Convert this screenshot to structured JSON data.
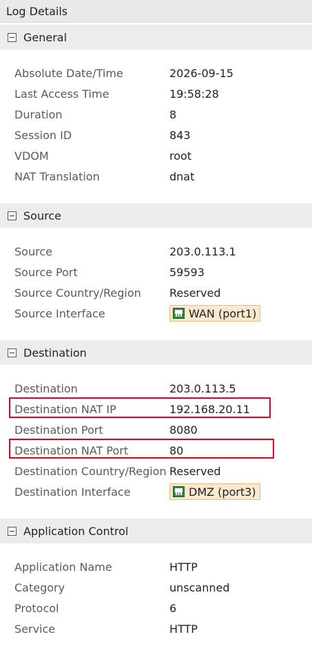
{
  "panel": {
    "title": "Log Details"
  },
  "sections": {
    "general": {
      "title": "General",
      "rows": [
        {
          "label": "Absolute Date/Time",
          "value": "2026-09-15"
        },
        {
          "label": "Last Access Time",
          "value": "19:58:28"
        },
        {
          "label": "Duration",
          "value": "8"
        },
        {
          "label": "Session ID",
          "value": "843"
        },
        {
          "label": "VDOM",
          "value": "root"
        },
        {
          "label": "NAT Translation",
          "value": "dnat"
        }
      ]
    },
    "source": {
      "title": "Source",
      "rows": [
        {
          "label": "Source",
          "value": "203.0.113.1"
        },
        {
          "label": "Source Port",
          "value": "59593"
        },
        {
          "label": "Source Country/Region",
          "value": "Reserved"
        },
        {
          "label": "Source Interface",
          "value": "WAN (port1)",
          "icon": "network-port-icon"
        }
      ]
    },
    "destination": {
      "title": "Destination",
      "rows": [
        {
          "label": "Destination",
          "value": "203.0.113.5"
        },
        {
          "label": "Destination NAT IP",
          "value": "192.168.20.11",
          "highlighted": true
        },
        {
          "label": "Destination Port",
          "value": "8080"
        },
        {
          "label": "Destination NAT Port",
          "value": "80",
          "highlighted": true
        },
        {
          "label": "Destination Country/Region",
          "value": "Reserved"
        },
        {
          "label": "Destination Interface",
          "value": "DMZ (port3)",
          "icon": "network-port-icon"
        }
      ]
    },
    "application": {
      "title": "Application Control",
      "rows": [
        {
          "label": "Application Name",
          "value": "HTTP"
        },
        {
          "label": "Category",
          "value": "unscanned"
        },
        {
          "label": "Protocol",
          "value": "6"
        },
        {
          "label": "Service",
          "value": "HTTP"
        }
      ]
    }
  },
  "colors": {
    "highlight_border": "#e0001a",
    "interface_badge_bg": "#fbe9cf",
    "interface_icon": "#2f8a3a"
  }
}
